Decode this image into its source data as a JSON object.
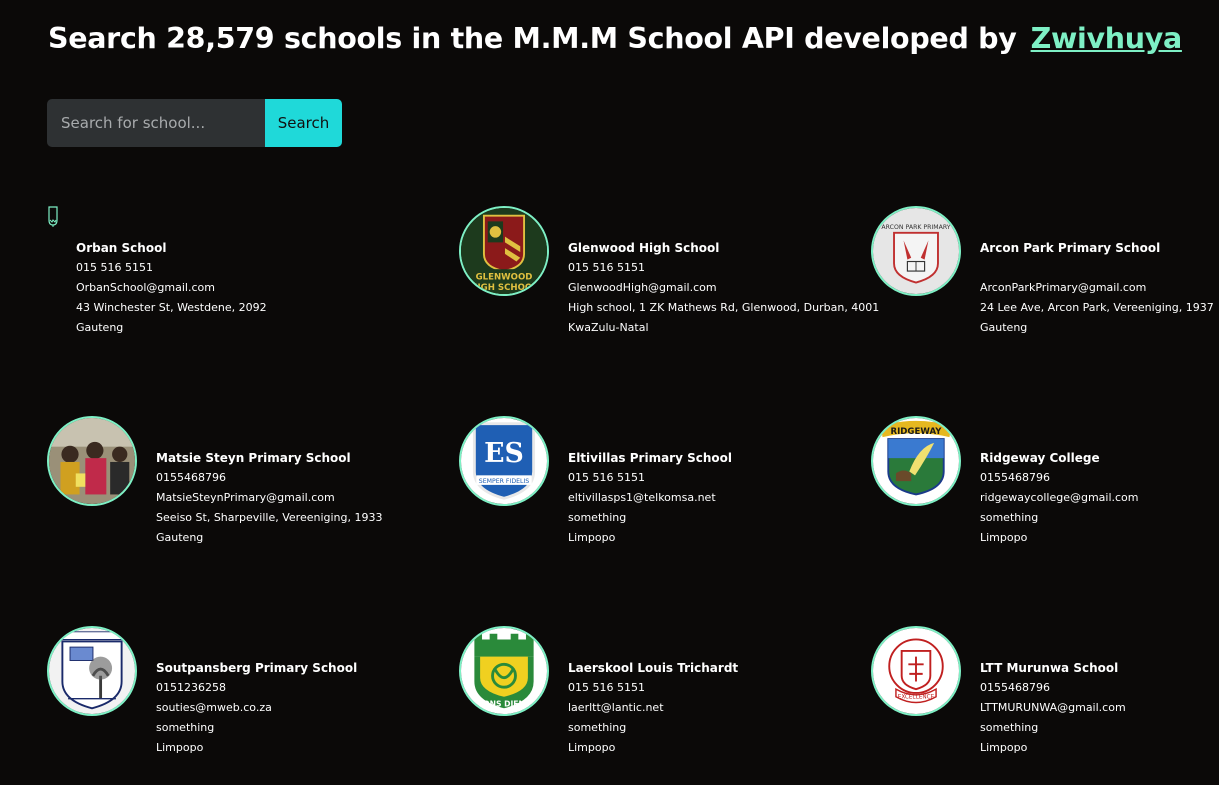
{
  "header": {
    "title_text": "Search 28,579 schools in the M.M.M School API developed by",
    "author_link": "Zwivhuya"
  },
  "search": {
    "placeholder": "Search for school...",
    "button_label": "Search"
  },
  "schools": [
    {
      "name": "Orban School",
      "phone": "015 516 5151",
      "email": "OrbanSchool@gmail.com",
      "address": "43 Winchester St, Westdene, 2092",
      "province": "Gauteng"
    },
    {
      "name": "Glenwood High School",
      "phone": "015 516 5151",
      "email": "GlenwoodHigh@gmail.com",
      "address": "High school, 1 ZK Mathews Rd, Glenwood, Durban, 4001",
      "province": "KwaZulu-Natal",
      "logo_text": "GLENWOOD HIGH SCHOOL"
    },
    {
      "name": "Arcon Park Primary School",
      "phone": "",
      "email": "ArconParkPrimary@gmail.com",
      "address": "24 Lee Ave, Arcon Park, Vereeniging, 1937",
      "province": "Gauteng",
      "logo_text": "ARCON PARK PRIMARY"
    },
    {
      "name": "Matsie Steyn Primary School",
      "phone": "0155468796",
      "email": "MatsieSteynPrimary@gmail.com",
      "address": "Seeiso St, Sharpeville, Vereeniging, 1933",
      "province": "Gauteng"
    },
    {
      "name": "Eltivillas Primary School",
      "phone": "015 516 5151",
      "email": "eltivillasps1@telkomsa.net",
      "address": "something",
      "province": "Limpopo",
      "logo_text": "SEMPER FIDELIS"
    },
    {
      "name": "Ridgeway College",
      "phone": "0155468796",
      "email": "ridgewaycollege@gmail.com",
      "address": "something",
      "province": "Limpopo",
      "logo_text": "RIDGEWAY"
    },
    {
      "name": "Soutpansberg Primary School",
      "phone": "0151236258",
      "email": "souties@mweb.co.za",
      "address": "something",
      "province": "Limpopo",
      "logo_text": "SOUTPANSBERG"
    },
    {
      "name": "Laerskool Louis Trichardt",
      "phone": "015 516 5151",
      "email": "laerltt@lantic.net",
      "address": "something",
      "province": "Limpopo",
      "logo_text": "ONS DIEN"
    },
    {
      "name": "LTT Murunwa School",
      "phone": "0155468796",
      "email": "LTTMURUNWA@gmail.com",
      "address": "something",
      "province": "Limpopo",
      "logo_text": "EXCELLENCE"
    }
  ],
  "colors": {
    "background": "#0b0908",
    "accent": "#7ef0c5",
    "button": "#1fd9d9",
    "input_bg": "#2e3133"
  }
}
